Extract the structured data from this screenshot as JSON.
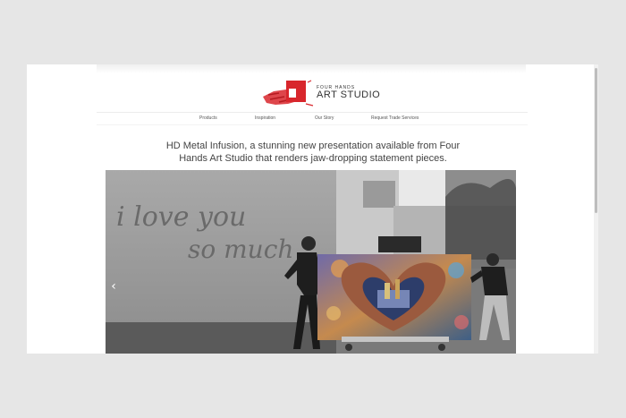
{
  "brand": {
    "small_text": "FOUR HANDS",
    "big_text": "ART STUDIO",
    "accent_color": "#d8262c"
  },
  "nav": {
    "items": [
      {
        "label": "Products"
      },
      {
        "label": "Inspiration"
      },
      {
        "label": "Our Story"
      },
      {
        "label": "Request Trade Services"
      }
    ]
  },
  "headline": {
    "line1": "HD Metal Infusion, a stunning new presentation available from Four",
    "line2": "Hands Art Studio that renders jaw-dropping statement pieces."
  },
  "hero": {
    "wall_text_line1": "i love you",
    "wall_text_line2": "so much",
    "prev_icon": "chevron-left-icon",
    "prev_glyph": "‹"
  }
}
